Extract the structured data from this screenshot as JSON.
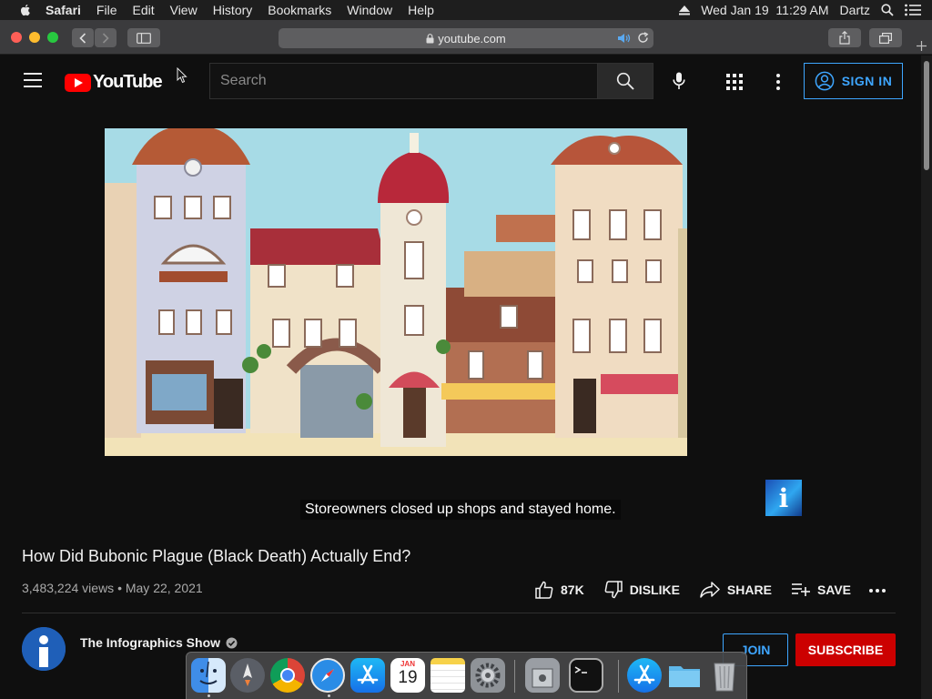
{
  "menubar": {
    "app_name": "Safari",
    "menus": [
      "File",
      "Edit",
      "View",
      "History",
      "Bookmarks",
      "Window",
      "Help"
    ],
    "datetime": "Wed Jan 19  11:29 AM",
    "user": "Dartz"
  },
  "browser": {
    "url": "youtube.com"
  },
  "youtube": {
    "logo_text": "YouTube",
    "search_placeholder": "Search",
    "sign_in": "SIGN IN"
  },
  "video": {
    "caption": "Storeowners closed up shops and stayed home.",
    "title": "How Did Bubonic Plague (Black Death) Actually End?",
    "meta": "3,483,224 views • May 22, 2021",
    "likes": "87K",
    "dislike": "DISLIKE",
    "share": "SHARE",
    "save": "SAVE",
    "info_badge": "i"
  },
  "channel": {
    "name": "The Infographics Show",
    "join": "JOIN",
    "subscribe": "SUBSCRIBE"
  },
  "dock": {
    "calendar_month": "JAN",
    "calendar_day": "19",
    "apps": [
      "finder-icon",
      "launchpad-icon",
      "chrome-icon",
      "safari-icon",
      "app-store-icon",
      "calendar-icon",
      "notes-icon",
      "system-preferences-icon",
      "utility-icon",
      "terminal-icon",
      "app-store-downloads-icon",
      "folder-icon",
      "trash-icon"
    ]
  },
  "colors": {
    "youtube_red": "#ff0000",
    "link_blue": "#3ea6ff",
    "subscribe_red": "#cc0000",
    "page_bg": "#0f0f0f"
  }
}
